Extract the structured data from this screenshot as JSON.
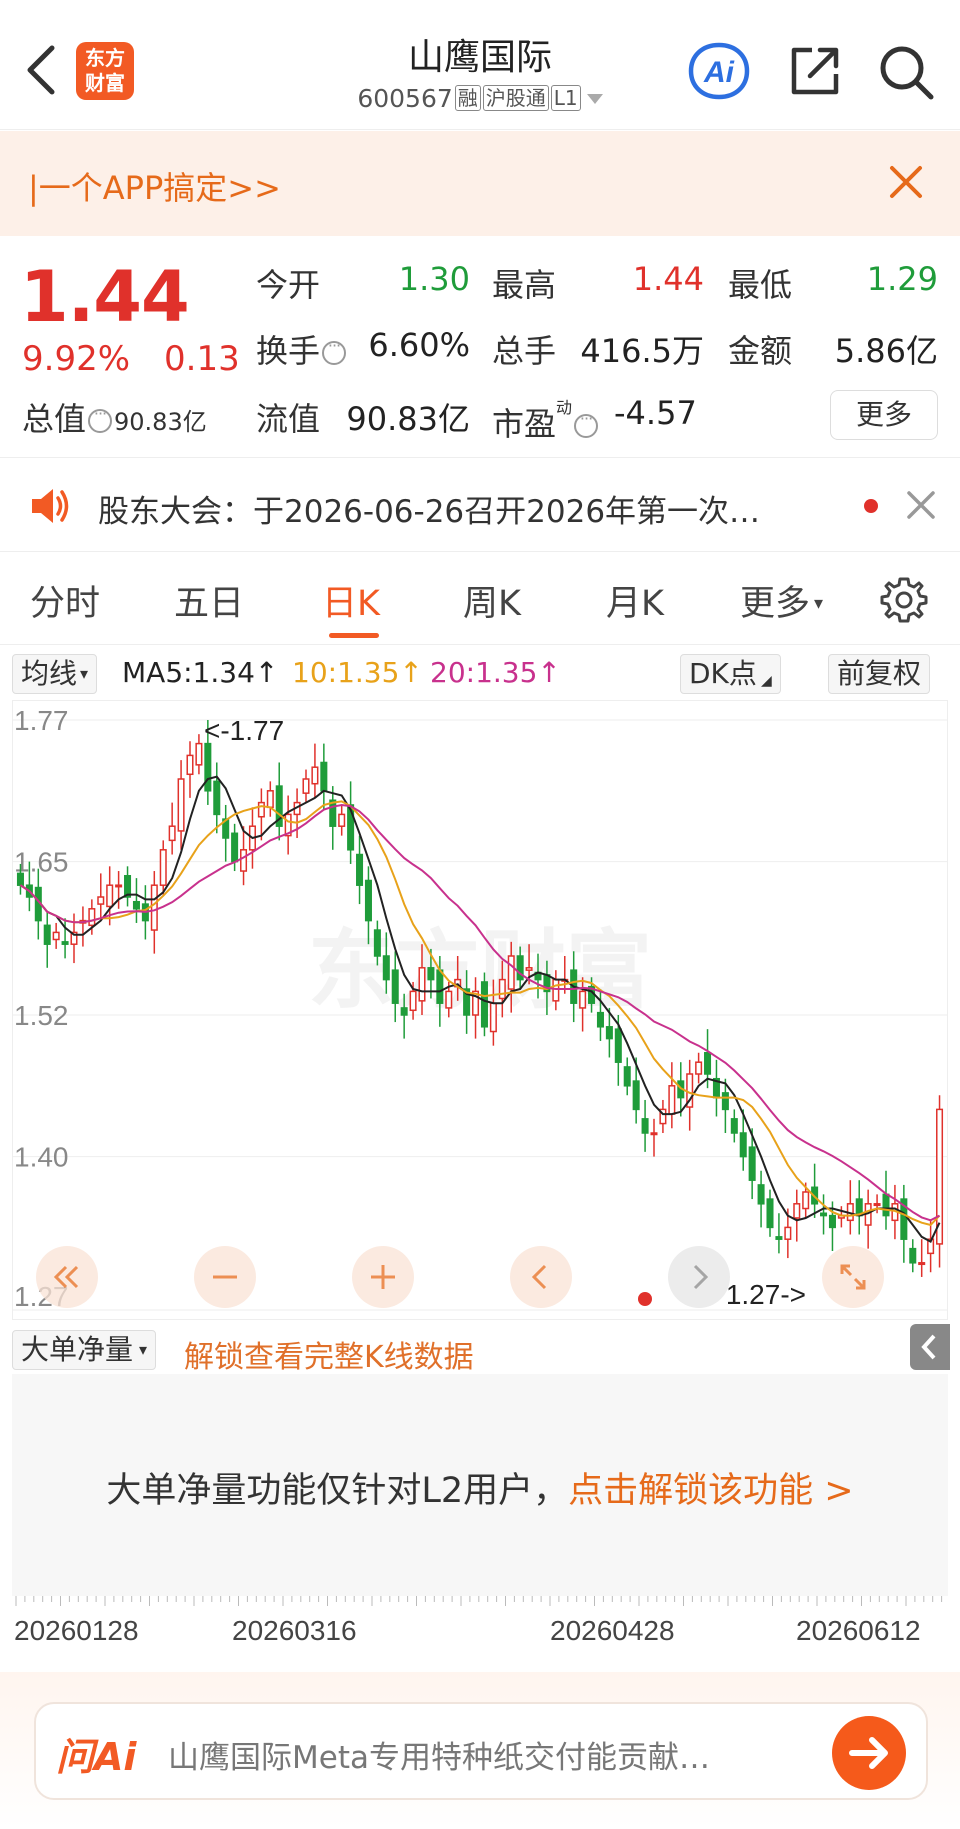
{
  "header": {
    "brand": "东方\n财富",
    "brand_line1": "东方",
    "brand_line2": "财富",
    "title": "山鹰国际",
    "code": "600567",
    "tags": [
      "融",
      "沪股通",
      "L1"
    ],
    "ai_label": "Ai"
  },
  "promo": {
    "text": "|一个APP搞定>>"
  },
  "quote": {
    "price": "1.44",
    "change_pct": "9.92%",
    "change_amt": "0.13",
    "total_value_label": "总值",
    "total_value": "90.83亿",
    "fields": [
      {
        "label": "今开",
        "value": "1.30",
        "color": "green"
      },
      {
        "label": "最高",
        "value": "1.44",
        "color": "red"
      },
      {
        "label": "最低",
        "value": "1.29",
        "color": "green"
      },
      {
        "label": "换手",
        "value": "6.60%",
        "color": "dark"
      },
      {
        "label": "总手",
        "value": "416.5万",
        "color": "dark"
      },
      {
        "label": "金额",
        "value": "5.86亿",
        "color": "dark"
      },
      {
        "label": "流值",
        "value": "90.83亿",
        "color": "dark"
      },
      {
        "label": "市盈",
        "value": "-4.57",
        "color": "dark",
        "sup": "动"
      }
    ],
    "more_label": "更多"
  },
  "notice": {
    "text": "股东大会：于2026-06-26召开2026年第一次…"
  },
  "tabs": {
    "items": [
      "分时",
      "五日",
      "日K",
      "周K",
      "月K",
      "更多"
    ],
    "active": "日K"
  },
  "indicators": {
    "ma_dropdown": "均线",
    "ma5": "MA5:1.34",
    "ma10": "10:1.35",
    "ma20": "20:1.35",
    "dk_label": "DK点",
    "adjust_label": "前复权",
    "colors": {
      "ma5": "#222222",
      "ma10": "#e8a21a",
      "ma20": "#c8318d",
      "up": "#e0312b",
      "down": "#1f9c3a"
    }
  },
  "chart_data": {
    "type": "candlestick",
    "y_ticks": [
      "1.77",
      "1.65",
      "1.52",
      "1.40",
      "1.27"
    ],
    "ylim": [
      1.27,
      1.77
    ],
    "max_annotation": "<-1.77",
    "min_annotation": "1.27->",
    "x_labels": [
      "20260128",
      "20260316",
      "20260428",
      "20260612"
    ],
    "watermark": "东方财富",
    "close": [
      1.63,
      1.62,
      1.6,
      1.58,
      1.59,
      1.58,
      1.59,
      1.6,
      1.61,
      1.62,
      1.63,
      1.63,
      1.62,
      1.61,
      1.6,
      1.63,
      1.66,
      1.68,
      1.72,
      1.74,
      1.75,
      1.71,
      1.69,
      1.67,
      1.65,
      1.66,
      1.68,
      1.7,
      1.71,
      1.68,
      1.69,
      1.7,
      1.72,
      1.73,
      1.71,
      1.68,
      1.69,
      1.66,
      1.63,
      1.6,
      1.57,
      1.55,
      1.53,
      1.52,
      1.54,
      1.56,
      1.55,
      1.53,
      1.54,
      1.55,
      1.52,
      1.54,
      1.51,
      1.53,
      1.55,
      1.57,
      1.55,
      1.56,
      1.55,
      1.54,
      1.55,
      1.55,
      1.53,
      1.54,
      1.53,
      1.51,
      1.5,
      1.48,
      1.46,
      1.44,
      1.42,
      1.42,
      1.44,
      1.46,
      1.45,
      1.47,
      1.48,
      1.47,
      1.45,
      1.44,
      1.42,
      1.4,
      1.38,
      1.36,
      1.34,
      1.33,
      1.34,
      1.36,
      1.37,
      1.36,
      1.35,
      1.34,
      1.35,
      1.36,
      1.35,
      1.36,
      1.36,
      1.35,
      1.36,
      1.33,
      1.31,
      1.31,
      1.33,
      1.44
    ],
    "ma_legend": [
      "MA5",
      "10",
      "20"
    ]
  },
  "volume": {
    "dropdown": "大单净量",
    "lock_text": "解锁查看完整K线数据",
    "unlock_prefix": "大单净量功能仅针对L2用户，",
    "unlock_link": "点击解锁该功能 >"
  },
  "ask": {
    "brand": "问Ai",
    "question": "山鹰国际Meta专用特种纸交付能贡献…"
  }
}
